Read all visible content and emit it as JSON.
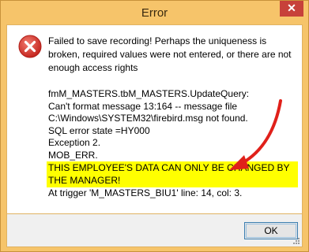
{
  "window": {
    "title": "Error",
    "close_glyph": "✕"
  },
  "message": {
    "main": "Failed to save recording! Perhaps the uniqueness is broken, required values were not entered, or there are not enough access rights",
    "details": [
      "fmM_MASTERS.tbM_MASTERS.UpdateQuery:",
      "Can't format message 13:164 -- message file",
      "C:\\Windows\\SYSTEM32\\firebird.msg not found.",
      "SQL error state =HY000",
      "Exception 2.",
      "MOB_ERR."
    ],
    "highlighted": "THIS EMPLOYEE'S DATA CAN ONLY BE CHANGED BY THE MANAGER!",
    "trigger_line": "At trigger 'M_MASTERS_BIU1' line: 14, col: 3."
  },
  "buttons": {
    "ok_label": "OK"
  },
  "icons": {
    "error": "error-x-icon",
    "close": "close-icon",
    "annotation": "red-arrow-icon"
  },
  "colors": {
    "title_bar": "#f6c46a",
    "close_button": "#c7413a",
    "highlight": "#ffff00",
    "arrow": "#e0201a",
    "error_icon": "#d9312b"
  }
}
